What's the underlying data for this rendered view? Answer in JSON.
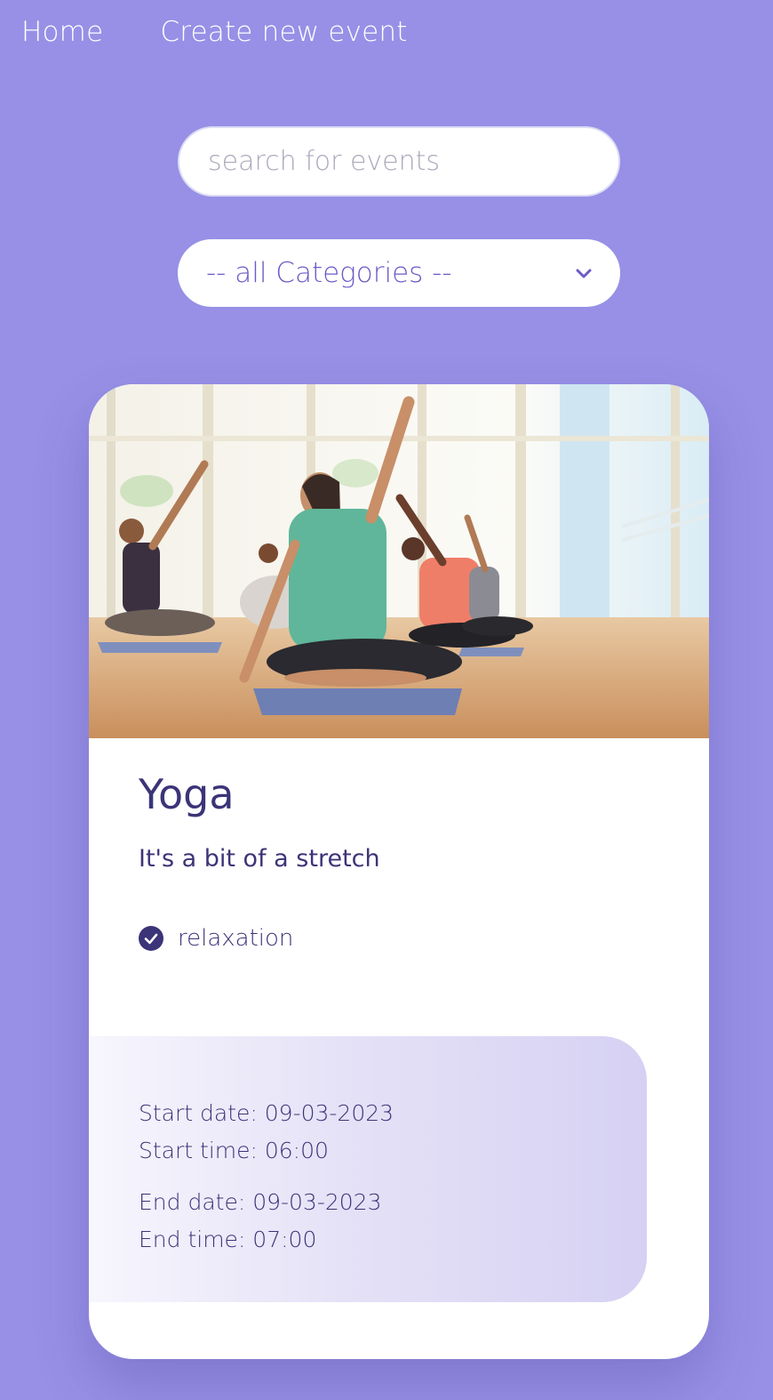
{
  "nav": {
    "home_label": "Home",
    "create_label": "Create new event"
  },
  "search": {
    "placeholder": "search for events",
    "value": ""
  },
  "category_select": {
    "selected": "-- all Categories --",
    "icon": "chevron-down-icon"
  },
  "event": {
    "image_icon": "yoga-class-photo",
    "title": "Yoga",
    "subtitle": "It's a bit of a stretch",
    "category": "relaxation",
    "start_date": "Start date: 09-03-2023",
    "start_time": "Start time: 06:00",
    "end_date": "End date: 09-03-2023",
    "end_time": "End time: 07:00"
  },
  "colors": {
    "background": "#9790e6",
    "accent": "#3c3478",
    "select_text": "#6a5bc8"
  }
}
